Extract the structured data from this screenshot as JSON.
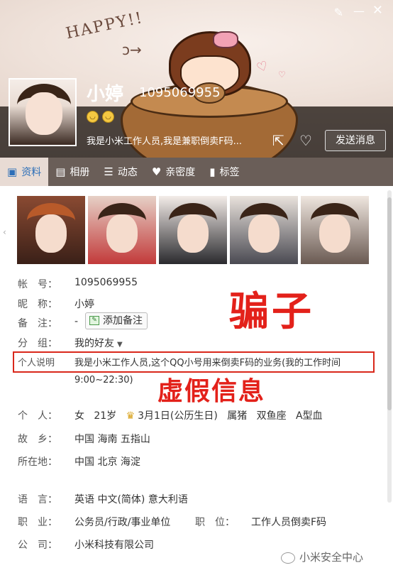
{
  "header": {
    "banner_text": "HAPPY!!",
    "nickname": "小婷",
    "qq_number": "1095069955",
    "signature": "我是小米工作人员,我是兼职倒卖F码...",
    "send_button": "发送消息",
    "icons": [
      "skin-icon",
      "minimize-icon",
      "close-icon",
      "share-icon",
      "heart-plus-icon"
    ]
  },
  "tabs": [
    {
      "label": "资料",
      "icon": "profile-icon",
      "active": true
    },
    {
      "label": "相册",
      "icon": "album-icon",
      "active": false
    },
    {
      "label": "动态",
      "icon": "feed-icon",
      "active": false
    },
    {
      "label": "亲密度",
      "icon": "heart-icon",
      "active": false
    },
    {
      "label": "标签",
      "icon": "tag-icon",
      "active": false
    }
  ],
  "info": {
    "account": {
      "label": "帐　号：",
      "value": "1095069955"
    },
    "nickname": {
      "label": "昵　称：",
      "value": "小婷"
    },
    "remark": {
      "label": "备　注：",
      "value": "-",
      "button": "添加备注"
    },
    "group": {
      "label": "分　组：",
      "value": "我的好友"
    },
    "description": {
      "label": "个人说明",
      "value": "我是小米工作人员,这个QQ小号用来倒卖F码的业务(我的工作时间",
      "value2": "9:00~22:30)"
    },
    "personal": {
      "label": "个　人：",
      "gender": "女",
      "age": "21岁",
      "birthday": "3月1日(公历生日)",
      "zodiac": "属猪",
      "constellation": "双鱼座",
      "blood": "A型血"
    },
    "hometown": {
      "label": "故　乡：",
      "value": "中国 海南 五指山"
    },
    "location": {
      "label": "所在地：",
      "value": "中国 北京 海淀"
    },
    "language": {
      "label": "语　言：",
      "value": "英语   中文(简体)   意大利语"
    },
    "job": {
      "label": "职　业：",
      "value": "公务员/行政/事业单位",
      "position_label": "职　位：",
      "position_value": "工作人员倒卖F码"
    },
    "company": {
      "label": "公　司：",
      "value": "小米科技有限公司"
    }
  },
  "annotations": {
    "scam": "骗子",
    "fake_info": "虚假信息",
    "color": "#e3211a"
  },
  "watermark": "小米安全中心"
}
